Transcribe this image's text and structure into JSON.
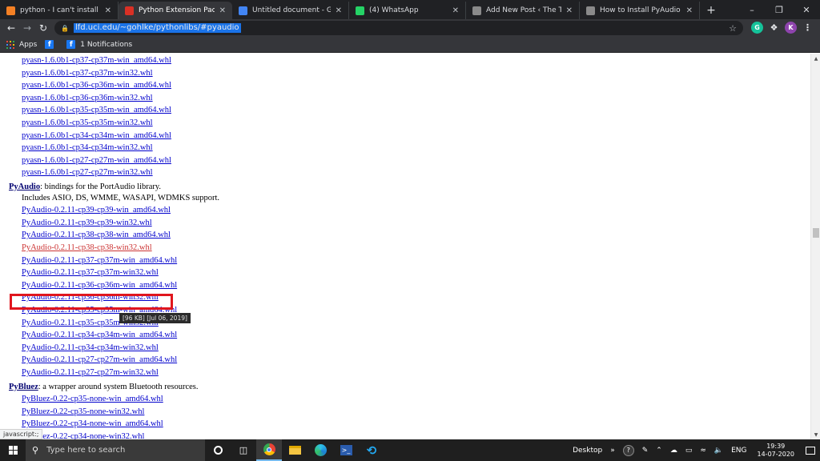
{
  "tabs": [
    {
      "title": "python - I can't install pyaudio",
      "favicon": "stackoverflow-icon",
      "color": "#f48024",
      "active": false
    },
    {
      "title": "Python Extension Packages fo",
      "favicon": "uci-icon",
      "color": "#d93025",
      "active": true
    },
    {
      "title": "Untitled document - Google",
      "favicon": "google-docs-icon",
      "color": "#4285f4",
      "active": false
    },
    {
      "title": "(4) WhatsApp",
      "favicon": "whatsapp-icon",
      "color": "#25d366",
      "active": false
    },
    {
      "title": "Add New Post ‹ The Tech Inf",
      "favicon": "wordpress-icon",
      "color": "#8a8a8a",
      "active": false
    },
    {
      "title": "How to Install PyAudio Mod",
      "favicon": "article-icon",
      "color": "#8a8a8a",
      "active": false
    }
  ],
  "address": {
    "url": "lfd.uci.edu/~gohlke/pythonlibs/#pyaudio"
  },
  "profile": {
    "initial": "K",
    "color": "#8e44ad"
  },
  "grammarly": {
    "initial": "G",
    "color": "#15c39a"
  },
  "bookmarks": {
    "apps": "Apps",
    "notifications": "1 Notifications"
  },
  "pyasn_links": [
    "pyasn-1.6.0b1-cp37-cp37m-win_amd64.whl",
    "pyasn-1.6.0b1-cp37-cp37m-win32.whl",
    "pyasn-1.6.0b1-cp36-cp36m-win_amd64.whl",
    "pyasn-1.6.0b1-cp36-cp36m-win32.whl",
    "pyasn-1.6.0b1-cp35-cp35m-win_amd64.whl",
    "pyasn-1.6.0b1-cp35-cp35m-win32.whl",
    "pyasn-1.6.0b1-cp34-cp34m-win_amd64.whl",
    "pyasn-1.6.0b1-cp34-cp34m-win32.whl",
    "pyasn-1.6.0b1-cp27-cp27m-win_amd64.whl",
    "pyasn-1.6.0b1-cp27-cp27m-win32.whl"
  ],
  "pyaudio": {
    "name": "PyAudio",
    "desc": ": bindings for the PortAudio library.",
    "includes": "Includes ASIO, DS, WMME, WASAPI, WDMKS support.",
    "links": [
      "PyAudio-0.2.11-cp39-cp39-win_amd64.whl",
      "PyAudio-0.2.11-cp39-cp39-win32.whl",
      "PyAudio-0.2.11-cp38-cp38-win_amd64.whl",
      "PyAudio-0.2.11-cp38-cp38-win32.whl",
      "PyAudio-0.2.11-cp37-cp37m-win_amd64.whl",
      "PyAudio-0.2.11-cp37-cp37m-win32.whl",
      "PyAudio-0.2.11-cp36-cp36m-win_amd64.whl",
      "PyAudio-0.2.11-cp36-cp36m-win32.whl",
      "PyAudio-0.2.11-cp35-cp35m-win_amd64.whl",
      "PyAudio-0.2.11-cp35-cp35m-win32.whl",
      "PyAudio-0.2.11-cp34-cp34m-win_amd64.whl",
      "PyAudio-0.2.11-cp34-cp34m-win32.whl",
      "PyAudio-0.2.11-cp27-cp27m-win_amd64.whl",
      "PyAudio-0.2.11-cp27-cp27m-win32.whl"
    ],
    "hovered_index": 3,
    "tooltip": "[96 KB] [Jul 06, 2019]"
  },
  "pybluez": {
    "name": "PyBluez",
    "desc": ": a wrapper around system Bluetooth resources.",
    "links": [
      "PyBluez-0.22-cp35-none-win_amd64.whl",
      "PyBluez-0.22-cp35-none-win32.whl",
      "PyBluez-0.22-cp34-none-win_amd64.whl",
      "PyBluez-0.22-cp34-none-win32.whl"
    ]
  },
  "status": "javascript:;",
  "taskbar": {
    "search_placeholder": "Type here to search",
    "desktop": "Desktop",
    "lang": "ENG",
    "time": "19:39",
    "date": "14-07-2020"
  },
  "colors": {
    "highlight_box": "#e0161e",
    "link": "#0000cc"
  }
}
